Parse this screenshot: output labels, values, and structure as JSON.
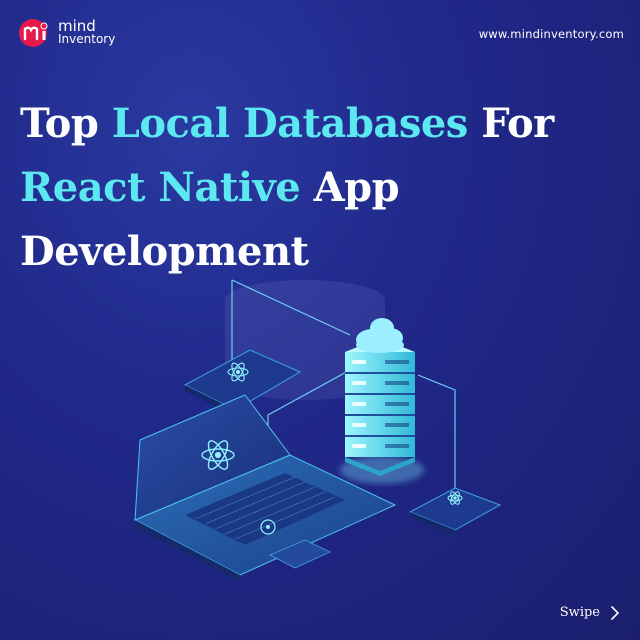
{
  "brand": {
    "logo_line1": "mind",
    "logo_line2": "Inventory",
    "website": "www.mindinventory.com"
  },
  "headline": {
    "line1_part1": "Top ",
    "line1_highlight": "Local Databases",
    "line1_part2": " For",
    "line2_highlight": "React Native",
    "line2_part2": " App",
    "line3": "Development"
  },
  "footer": {
    "swipe_label": "Swipe"
  },
  "icons": [
    "mindinventory-logo-icon",
    "database-server-icon",
    "cloud-icon",
    "react-icon",
    "laptop-icon",
    "chevron-right-icon"
  ],
  "colors": {
    "background": "#20288a",
    "highlight": "#5ce8f0",
    "text": "#ffffff",
    "logo_red": "#e8194a"
  }
}
